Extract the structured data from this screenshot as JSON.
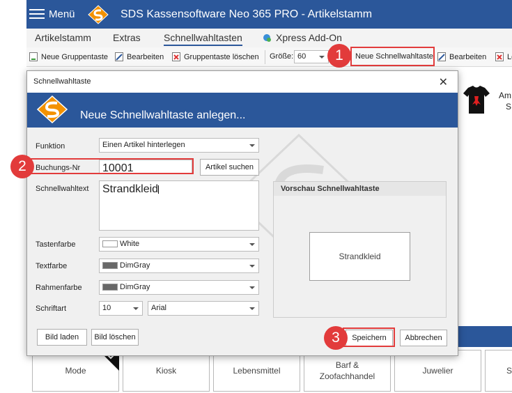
{
  "app": {
    "menu_label": "Menü",
    "window_title": "SDS Kassensoftware Neo 365 PRO - Artikelstamm"
  },
  "tabs": [
    {
      "label": "Artikelstamm"
    },
    {
      "label": "Extras"
    },
    {
      "label": "Schnellwahltasten",
      "active": true
    },
    {
      "label": "Xpress Add-On"
    }
  ],
  "toolbar": {
    "new_group": "Neue Gruppentaste",
    "edit1": "Bearbeiten",
    "delete_group": "Gruppentaste löschen",
    "size_label": "Größe:",
    "size_value": "60",
    "new_quick": "Neue Schnellwahltaste",
    "edit2": "Bearbeiten",
    "delete_partial": "Lö"
  },
  "background": {
    "product_text_1": "Am",
    "product_text_2": "S"
  },
  "categories": [
    {
      "label": "Mode"
    },
    {
      "label": "Kiosk"
    },
    {
      "label": "Lebensmittel"
    },
    {
      "label": "Barf &\nZoofachhandel"
    },
    {
      "label": "Juwelier"
    },
    {
      "label": "S"
    }
  ],
  "dialog": {
    "window_title": "Schnellwahltaste",
    "header_title": "Neue Schnellwahltaste anlegen...",
    "labels": {
      "funktion": "Funktion",
      "buchungsnr": "Buchungs-Nr",
      "schnellwahltext": "Schnellwahltext",
      "tastenfarbe": "Tastenfarbe",
      "textfarbe": "Textfarbe",
      "rahmenfarbe": "Rahmenfarbe",
      "schriftart": "Schriftart"
    },
    "values": {
      "funktion": "Einen Artikel hinterlegen",
      "buchungsnr": "10001",
      "schnellwahltext": "Strandkleid",
      "tastenfarbe": "White",
      "tastenfarbe_hex": "#ffffff",
      "textfarbe": "DimGray",
      "textfarbe_hex": "#696969",
      "rahmenfarbe": "DimGray",
      "rahmenfarbe_hex": "#696969",
      "schriftgroesse": "10",
      "schriftart": "Arial"
    },
    "buttons": {
      "artikel_suchen": "Artikel suchen",
      "bild_laden": "Bild laden",
      "bild_loeschen": "Bild löschen",
      "speichern": "Speichern",
      "abbrechen": "Abbrechen"
    },
    "preview": {
      "heading": "Vorschau Schnellwahltaste",
      "button_text": "Strandkleid"
    }
  },
  "annotations": {
    "step1": "1",
    "step2": "2",
    "step3": "3",
    "highlight_color": "#e23b3b"
  },
  "colors": {
    "primary": "#2b579a",
    "logo_orange": "#f39200"
  }
}
